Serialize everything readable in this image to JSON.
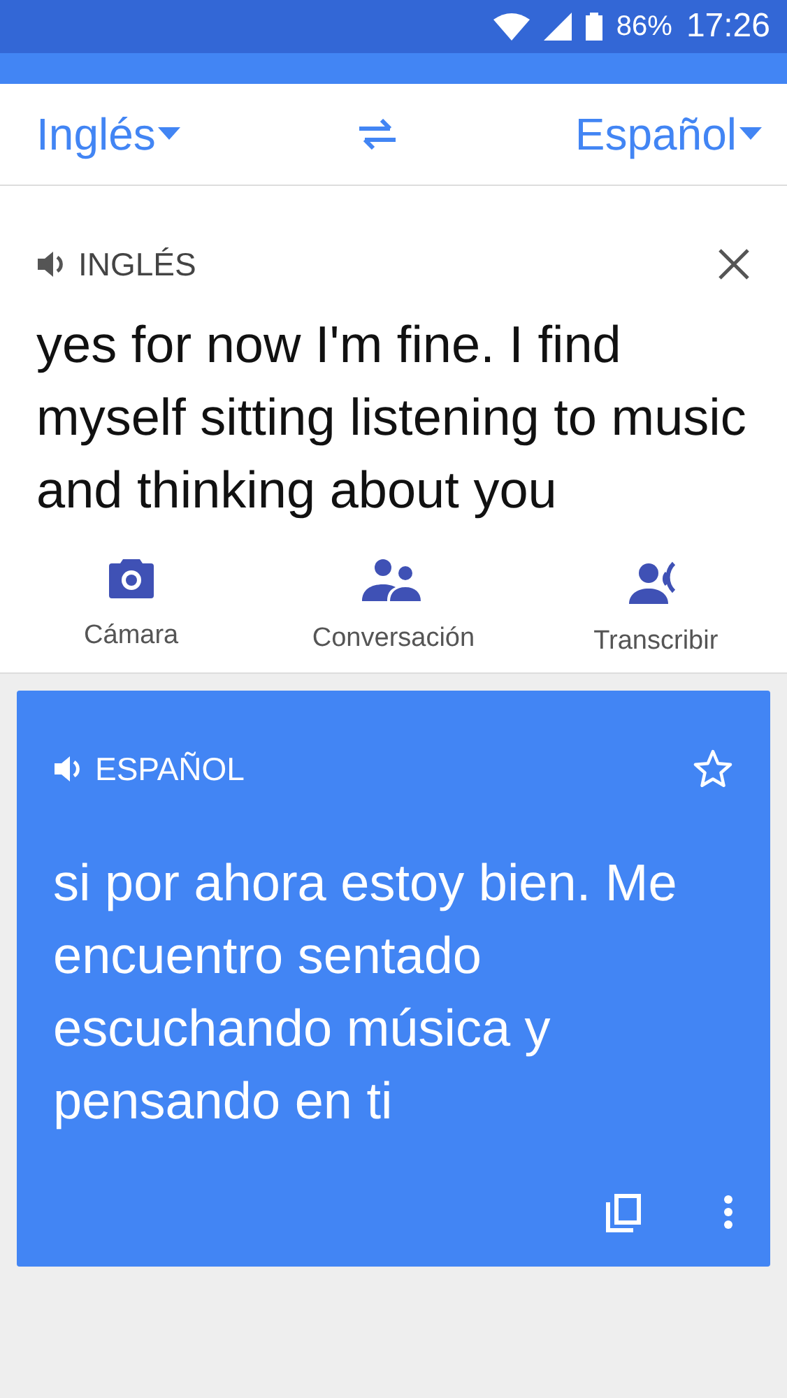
{
  "status_bar": {
    "battery": "86%",
    "time": "17:26"
  },
  "language_bar": {
    "source": "Inglés",
    "target": "Español"
  },
  "source": {
    "language": "INGLÉS",
    "text": "yes for now I'm fine. I find myself sitting listening to music and thinking about you"
  },
  "actions": [
    {
      "kind": "camera",
      "label": "Cámara"
    },
    {
      "kind": "conversation",
      "label": "Conversación"
    },
    {
      "kind": "transcribe",
      "label": "Transcribir"
    }
  ],
  "translation": {
    "language": "ESPAÑOL",
    "starred": false,
    "text": "si por ahora estoy bien. Me encuentro sentado escuchando música y pensando en ti"
  }
}
